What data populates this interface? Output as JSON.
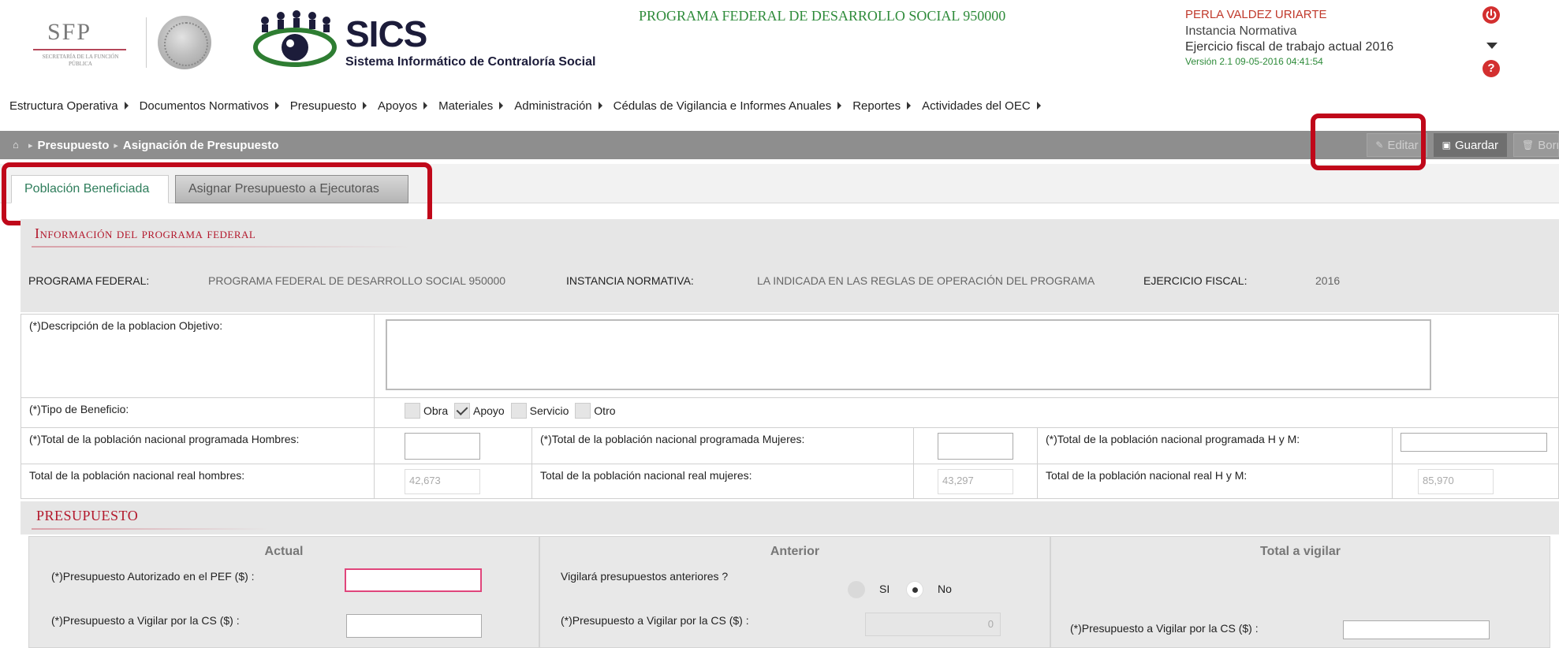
{
  "header": {
    "sfp_logo_text": "SFP",
    "sfp_logo_sub": "SECRETARÍA DE LA FUNCIÓN PÚBLICA",
    "sics_title": "SICS",
    "sics_subtitle": "Sistema Informático de Contraloría Social",
    "program_title": "PROGRAMA FEDERAL DE DESARROLLO SOCIAL 950000",
    "user_name": "PERLA VALDEZ URIARTE",
    "user_role": "Instancia Normativa",
    "fiscal_year_text": "Ejercicio fiscal de trabajo actual  2016",
    "version_text": "Versión 2.1   09-05-2016 04:41:54",
    "help_glyph": "?"
  },
  "menu": {
    "items": [
      {
        "label": "Estructura Operativa"
      },
      {
        "label": "Documentos Normativos"
      },
      {
        "label": "Presupuesto"
      },
      {
        "label": "Apoyos"
      },
      {
        "label": "Materiales"
      },
      {
        "label": "Administración"
      },
      {
        "label": "Cédulas de Vigilancia e Informes Anuales"
      },
      {
        "label": "Reportes"
      },
      {
        "label": "Actividades del OEC"
      }
    ]
  },
  "breadcrumb": {
    "items": [
      "Presupuesto",
      "Asignación de Presupuesto"
    ]
  },
  "toolbar": {
    "edit_label": "Editar",
    "save_label": "Guardar",
    "delete_label": "Borrar"
  },
  "tabs": [
    {
      "label": "Población Beneficiada",
      "active": true
    },
    {
      "label": "Asignar Presupuesto a Ejecutoras",
      "active": false
    }
  ],
  "info_section": {
    "title": "Información del programa federal",
    "programa_label": "PROGRAMA FEDERAL:",
    "programa_value": "PROGRAMA FEDERAL DE DESARROLLO SOCIAL 950000",
    "instancia_label": "INSTANCIA NORMATIVA:",
    "instancia_value": "LA INDICADA EN LAS REGLAS DE OPERACIÓN DEL PROGRAMA",
    "ejercicio_label": "EJERCICIO FISCAL:",
    "ejercicio_value": "2016"
  },
  "form": {
    "descripcion_label": "(*)Descripción de la poblacion Objetivo:",
    "descripcion_value": "",
    "tipo_label": "(*)Tipo de Beneficio:",
    "tipo_options": [
      {
        "label": "Obra",
        "checked": false
      },
      {
        "label": "Apoyo",
        "checked": true
      },
      {
        "label": "Servicio",
        "checked": false
      },
      {
        "label": "Otro",
        "checked": false
      }
    ],
    "prog_hombres_label": "(*)Total de la población nacional programada Hombres:",
    "prog_mujeres_label": "(*)Total de la población nacional programada Mujeres:",
    "prog_hym_label": "(*)Total de la población nacional programada H y M:",
    "real_hombres_label": "Total de la población nacional real hombres:",
    "real_hombres_value": "42,673",
    "real_mujeres_label": "Total de la población nacional real mujeres:",
    "real_mujeres_value": "43,297",
    "real_hym_label": "Total de la población nacional real H y M:",
    "real_hym_value": "85,970"
  },
  "presupuesto": {
    "title": "PRESUPUESTO",
    "actual": {
      "heading": "Actual",
      "autorizado_label": "(*)Presupuesto Autorizado en el PEF ($) :",
      "vigilar_label": "(*)Presupuesto a Vigilar por la CS ($) :"
    },
    "anterior": {
      "heading": "Anterior",
      "question_label": "Vigilará presupuestos anteriores ?",
      "yes_label": "SI",
      "no_label": "No",
      "selected": "No",
      "vigilar_label": "(*)Presupuesto a Vigilar por la CS ($) :",
      "vigilar_value": "0"
    },
    "total": {
      "heading": "Total a vigilar",
      "vigilar_label": "(*)Presupuesto a Vigilar por la CS ($) :"
    }
  },
  "colors": {
    "accent_red": "#c0081a",
    "title_green": "#2e8b3a",
    "section_red": "#b3182c",
    "breadcrumb_bg": "#8e8e8e"
  }
}
